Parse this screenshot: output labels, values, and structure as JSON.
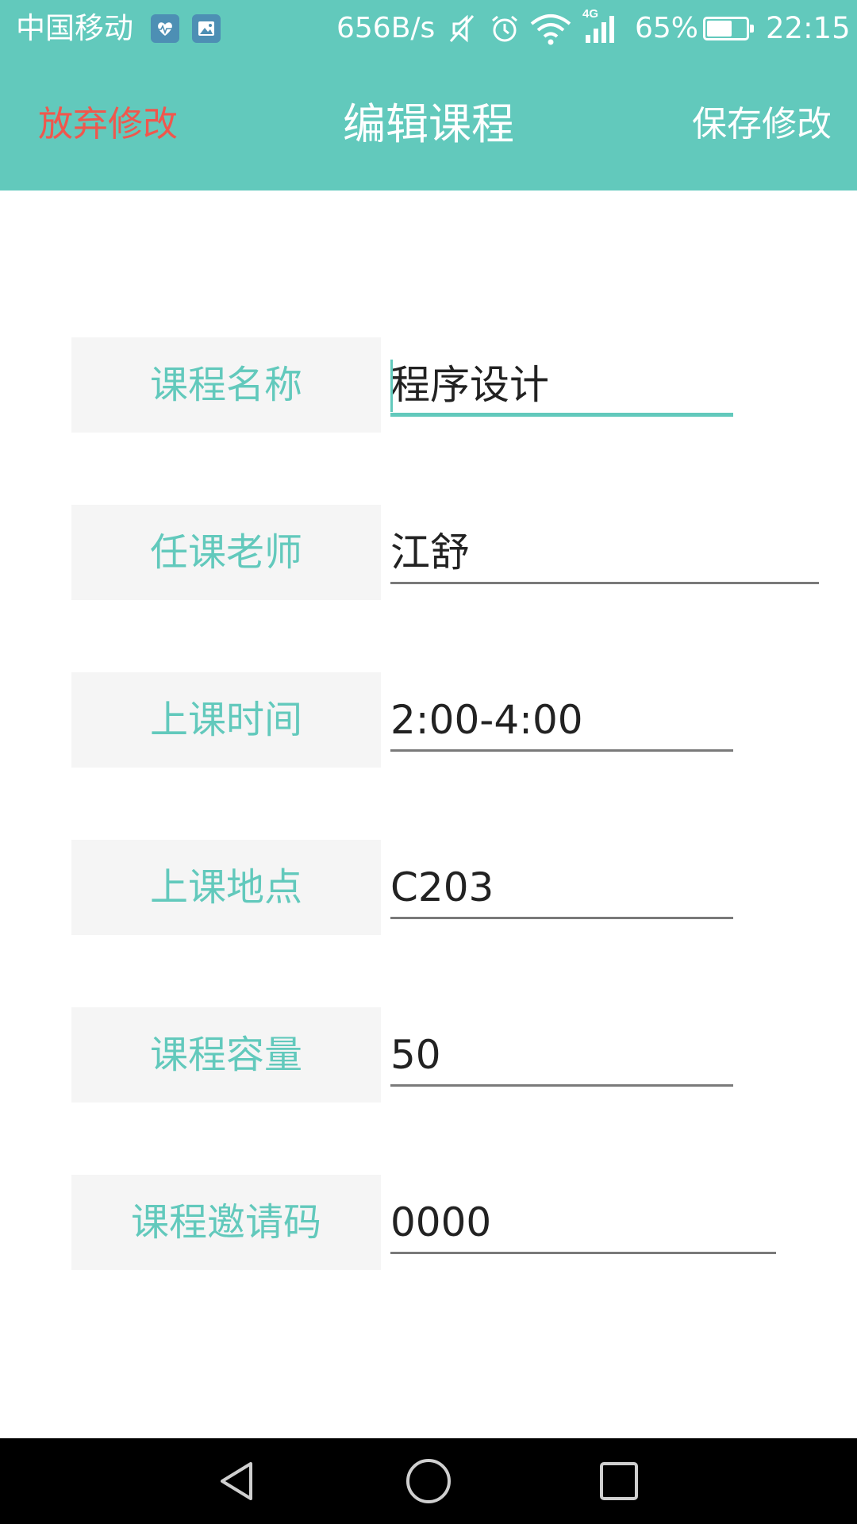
{
  "status_bar": {
    "carrier": "中国移动",
    "net_speed": "656B/s",
    "network_type": "4G",
    "battery": "65%",
    "battery_level": 0.65,
    "time": "22:15",
    "icons": [
      "health-app-icon",
      "gallery-app-icon",
      "mute-icon",
      "alarm-icon",
      "wifi-icon",
      "signal-icon",
      "battery-icon"
    ]
  },
  "action_bar": {
    "discard_label": "放弃修改",
    "title": "编辑课程",
    "save_label": "保存修改"
  },
  "form": {
    "rows": [
      {
        "label": "课程名称",
        "value": "程序设计"
      },
      {
        "label": "任课老师",
        "value": "江舒"
      },
      {
        "label": "上课时间",
        "value": "2:00-4:00"
      },
      {
        "label": "上课地点",
        "value": "C203"
      },
      {
        "label": "课程容量",
        "value": "50"
      },
      {
        "label": "课程邀请码",
        "value": "0000"
      }
    ]
  },
  "colors": {
    "accent": "#62c9bc",
    "discard": "#f0574d",
    "label_bg": "#f5f5f5",
    "nav_bg": "#000000"
  },
  "nav_bar": {
    "icons": [
      "back-icon",
      "home-icon",
      "recents-icon"
    ]
  }
}
